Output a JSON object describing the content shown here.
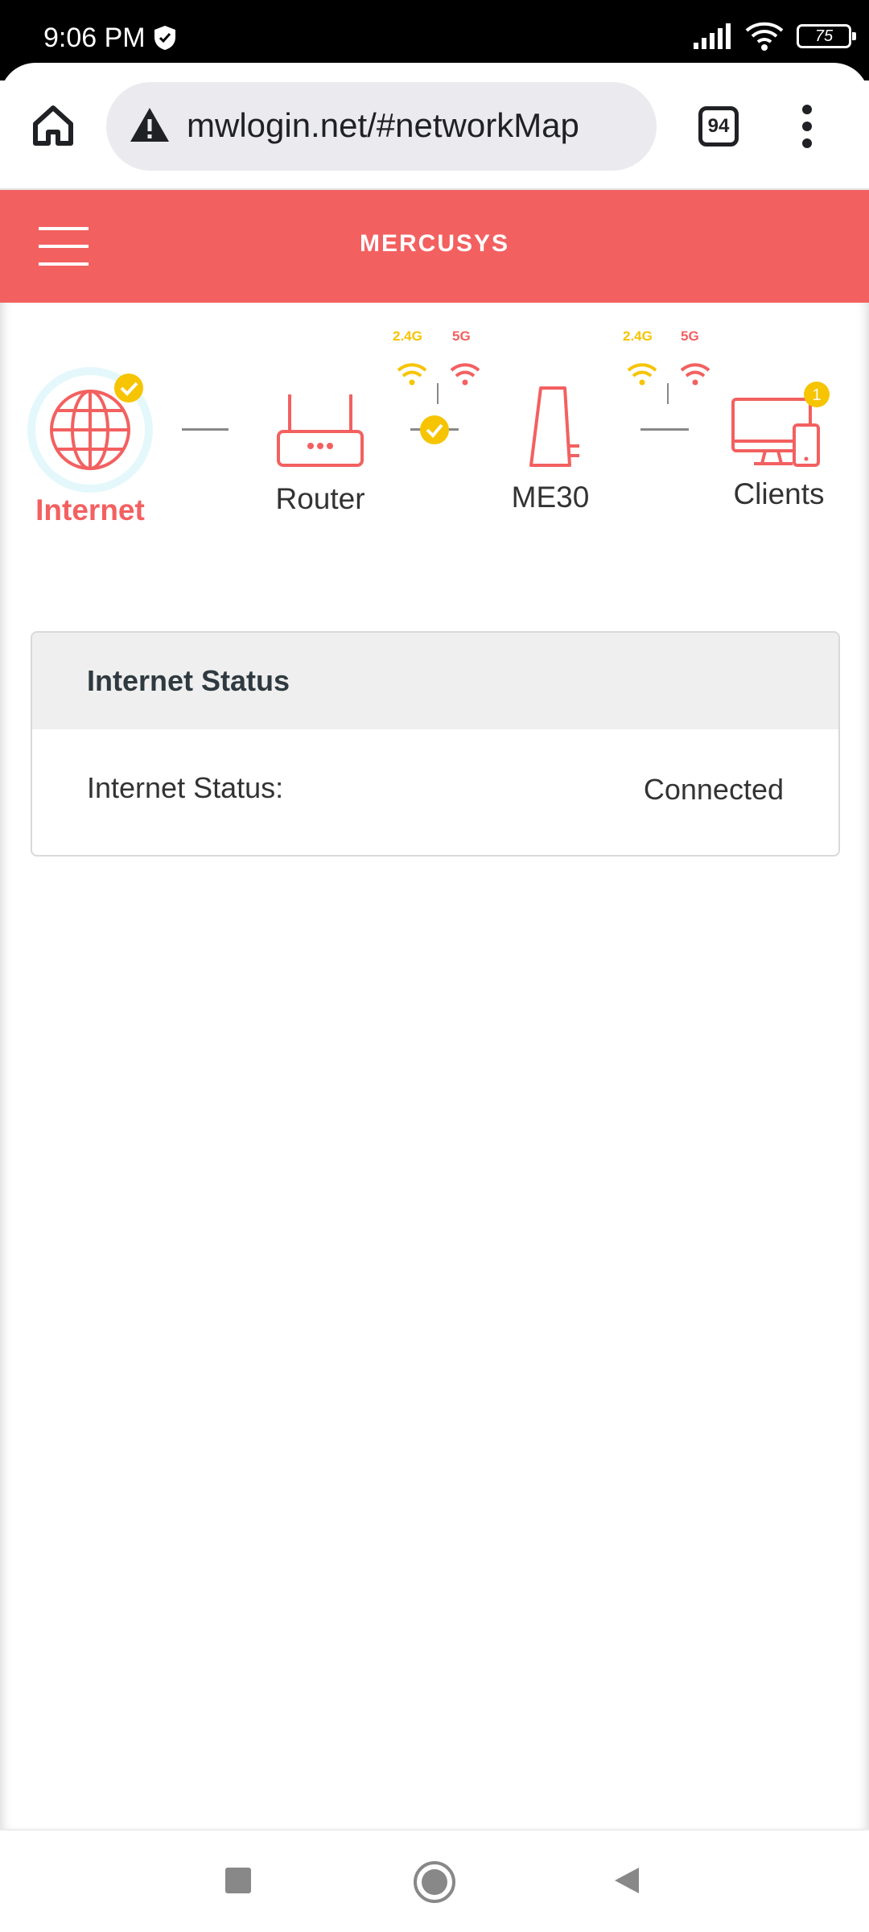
{
  "status_bar": {
    "time": "9:06 PM",
    "battery": "75"
  },
  "browser": {
    "url": "mwlogin.net/#networkMap",
    "tab_count": "94"
  },
  "header": {
    "brand": "MERCUSYS"
  },
  "network_map": {
    "nodes": [
      {
        "label": "Internet",
        "icon": "globe-icon",
        "status": "active"
      },
      {
        "label": "Router",
        "icon": "router-icon"
      },
      {
        "label": "ME30",
        "icon": "extender-icon"
      },
      {
        "label": "Clients",
        "icon": "clients-icon",
        "badge": "1"
      }
    ],
    "bands_left": {
      "band_24": "2.4G",
      "band_5": "5G"
    },
    "bands_right": {
      "band_24": "2.4G",
      "band_5": "5G"
    }
  },
  "status_card": {
    "title": "Internet Status",
    "row_label": "Internet Status:",
    "row_value": "Connected"
  },
  "colors": {
    "brand": "#f36060",
    "check": "#f6c400"
  }
}
